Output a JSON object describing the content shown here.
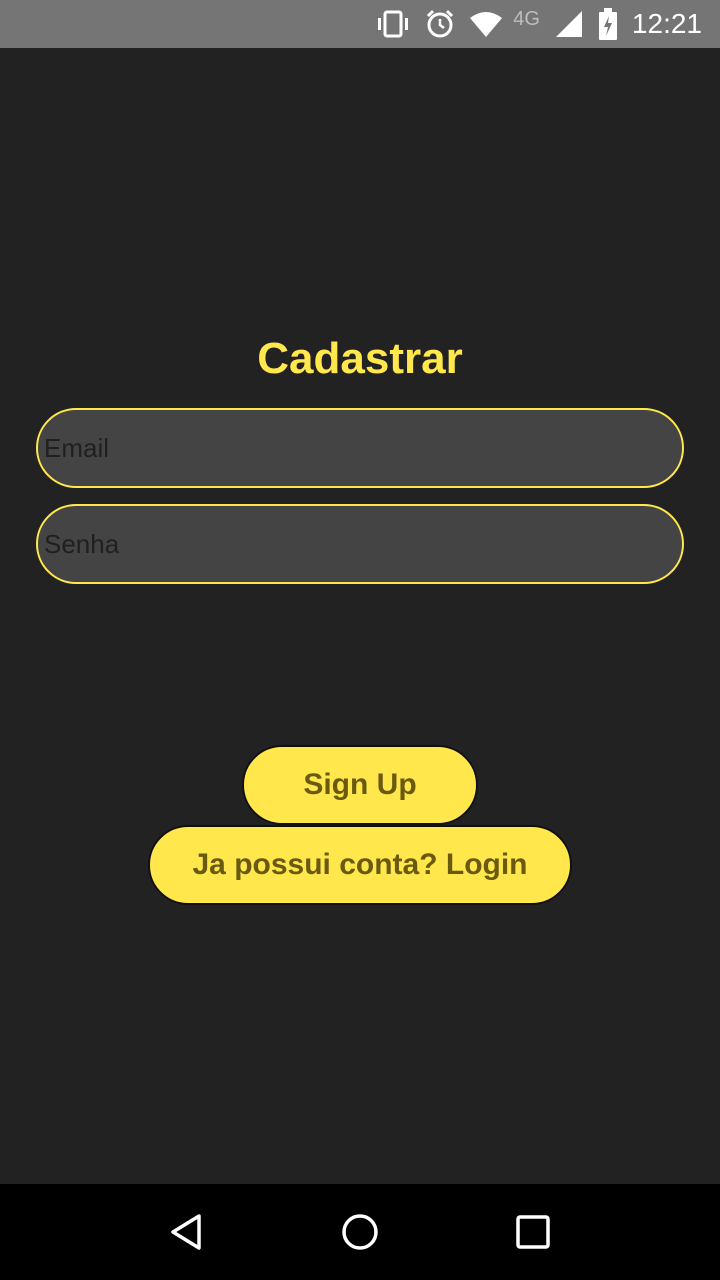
{
  "status_bar": {
    "network_label": "4G",
    "time": "12:21",
    "icons": [
      "vibrate-icon",
      "alarm-icon",
      "wifi-icon",
      "signal-icon",
      "battery-icon"
    ]
  },
  "form": {
    "title": "Cadastrar",
    "email_placeholder": "Email",
    "password_placeholder": "Senha",
    "signup_label": "Sign Up",
    "login_label": "Ja possui conta? Login"
  },
  "nav_bar": {
    "icons": [
      "back-icon",
      "home-icon",
      "recents-icon"
    ]
  },
  "colors": {
    "accent": "#ffe74c",
    "background": "#222222",
    "field_background": "#444444",
    "button_text": "#6a5a10"
  }
}
